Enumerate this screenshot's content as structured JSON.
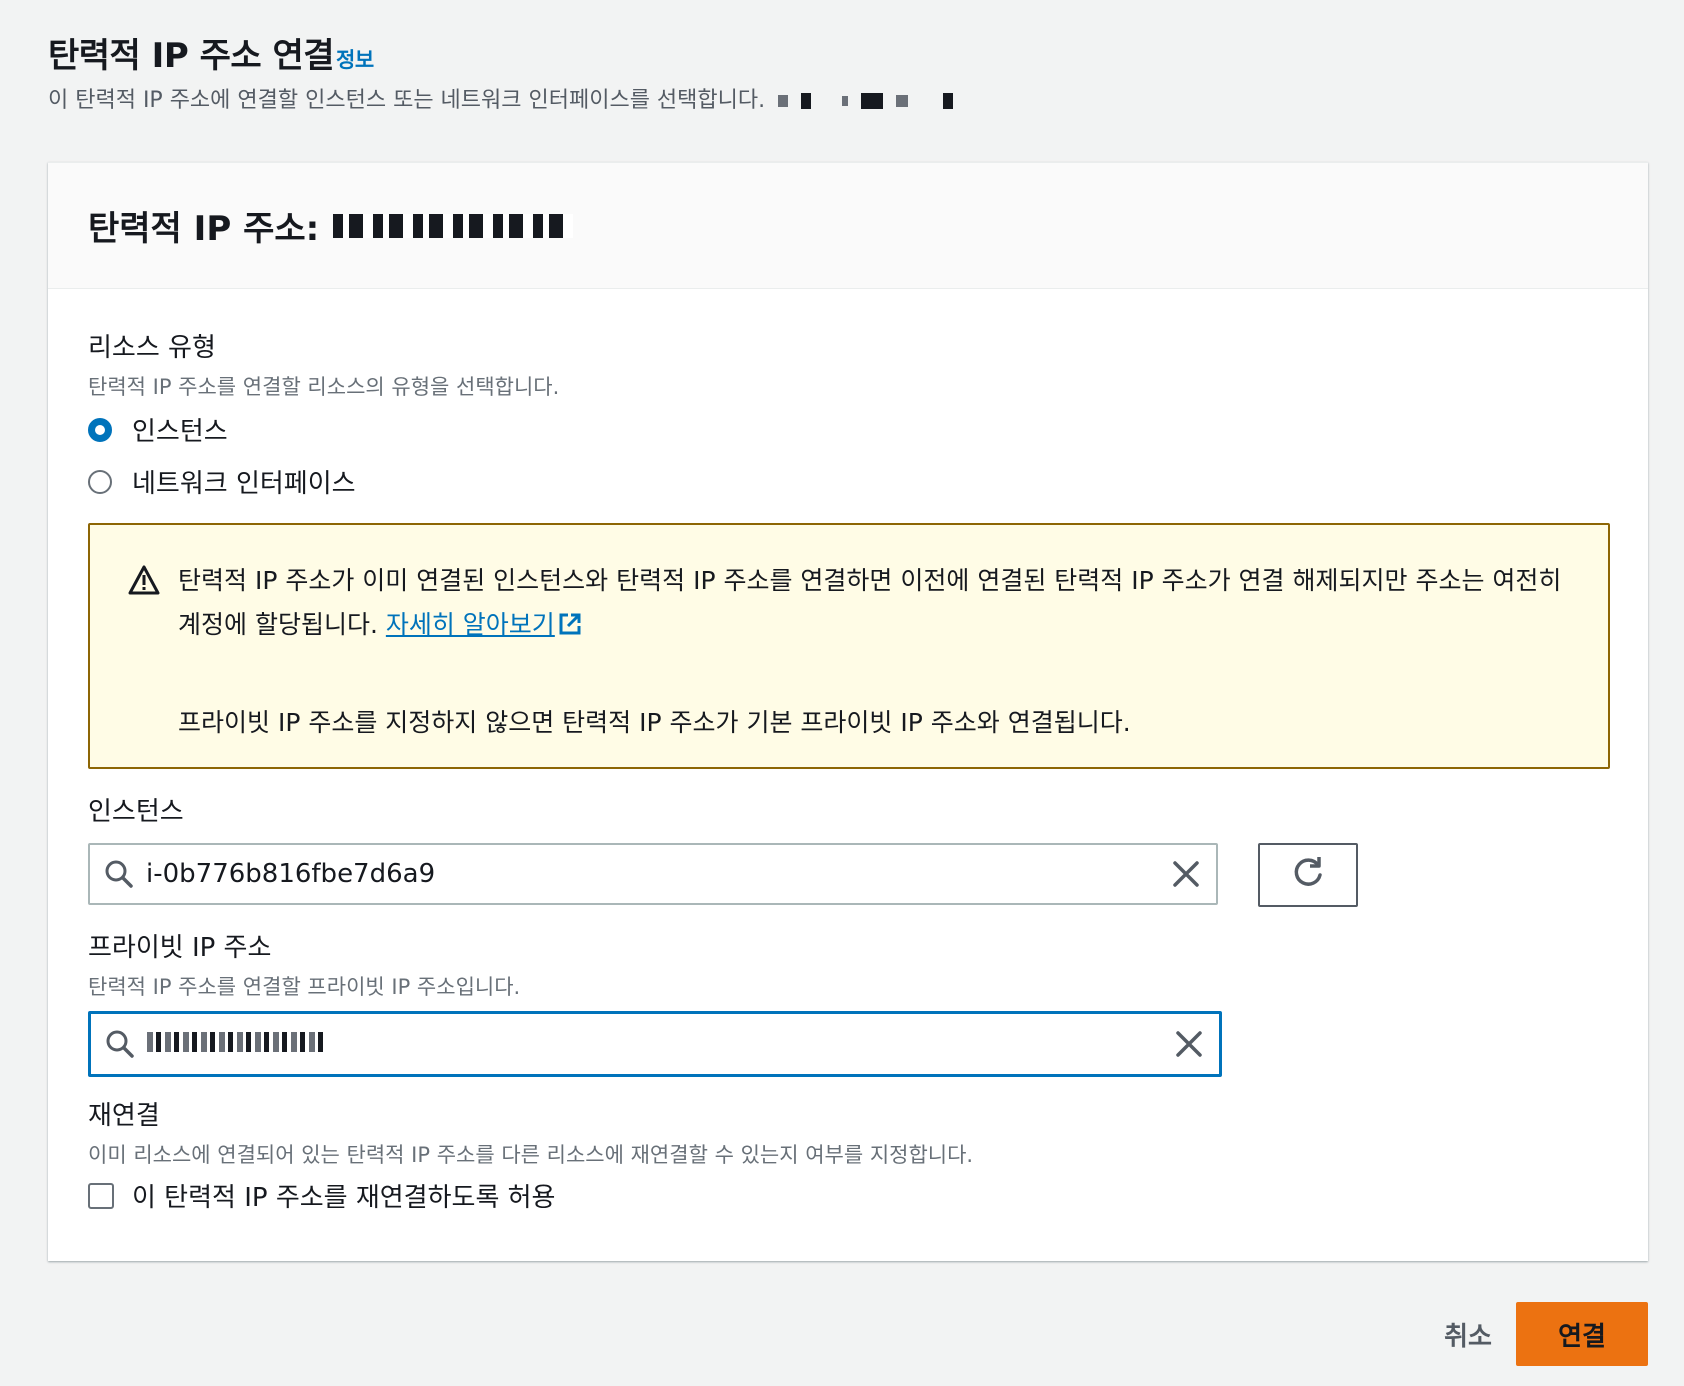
{
  "header": {
    "title": "탄력적 IP 주소 연결",
    "info_link": "정보",
    "description": "이 탄력적 IP 주소에 연결할 인스턴스 또는 네트워크 인터페이스를 선택합니다."
  },
  "panel": {
    "title": "탄력적 IP 주소:"
  },
  "resource_type": {
    "label": "리소스 유형",
    "description": "탄력적 IP 주소를 연결할 리소스의 유형을 선택합니다.",
    "options": [
      {
        "label": "인스턴스",
        "selected": true
      },
      {
        "label": "네트워크 인터페이스",
        "selected": false
      }
    ]
  },
  "alert": {
    "message_1": "탄력적 IP 주소가 이미 연결된 인스턴스와 탄력적 IP 주소를 연결하면 이전에 연결된 탄력적 IP 주소가 연결 해제되지만 주소는 여전히 계정에 할당됩니다.",
    "learn_more": "자세히 알아보기",
    "message_2": "프라이빗 IP 주소를 지정하지 않으면 탄력적 IP 주소가 기본 프라이빗 IP 주소와 연결됩니다."
  },
  "instance": {
    "label": "인스턴스",
    "value": "i-0b776b816fbe7d6a9"
  },
  "private_ip": {
    "label": "프라이빗 IP 주소",
    "description": "탄력적 IP 주소를 연결할 프라이빗 IP 주소입니다."
  },
  "reassociation": {
    "label": "재연결",
    "description": "이미 리소스에 연결되어 있는 탄력적 IP 주소를 다른 리소스에 재연결할 수 있는지 여부를 지정합니다.",
    "checkbox_label": "이 탄력적 IP 주소를 재연결하도록 허용",
    "checked": false
  },
  "footer": {
    "cancel": "취소",
    "associate": "연결"
  },
  "colors": {
    "accent": "#0073bb",
    "primary_button": "#ec7211",
    "warning_bg": "#fffce6",
    "warning_border": "#8d6605"
  }
}
